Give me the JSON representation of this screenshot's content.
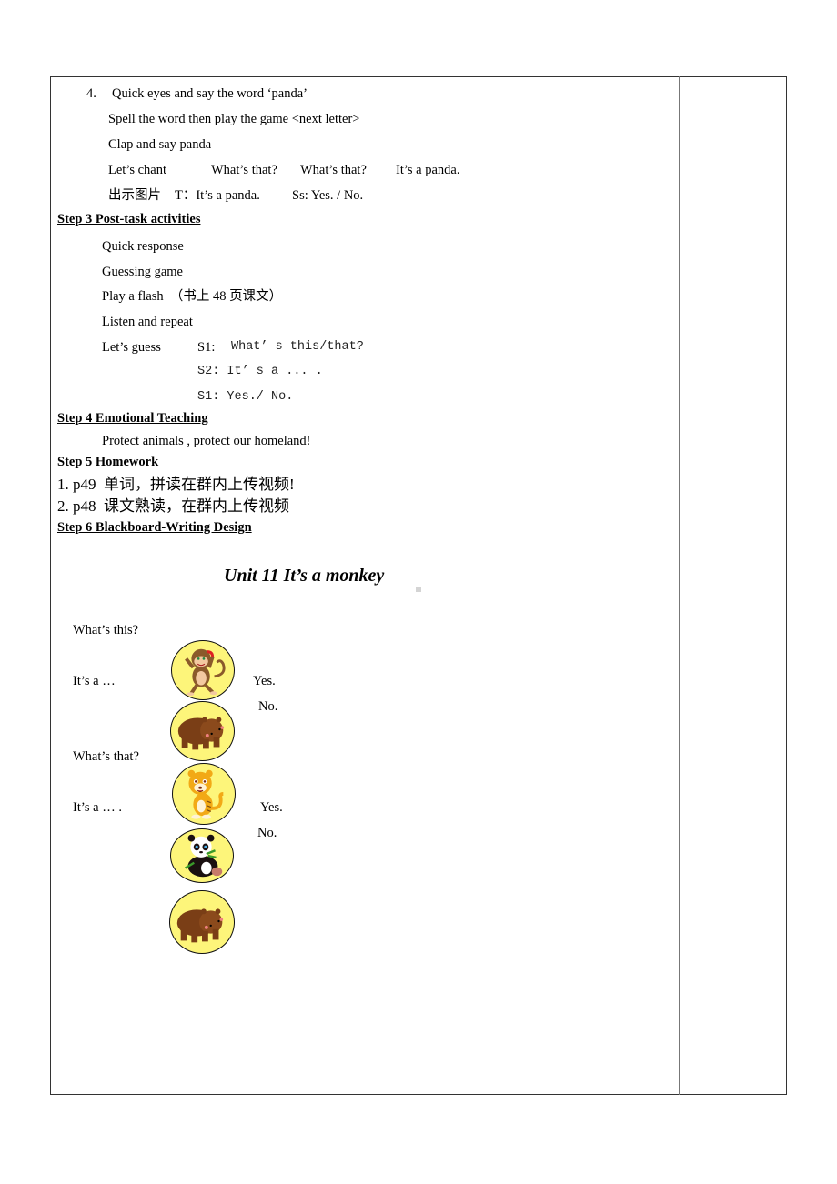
{
  "step2_tail": {
    "item4_number": "4.",
    "item4_text": "Quick eyes and say the word ‘panda’",
    "lines": [
      "Spell the word then play the game <next letter>",
      "Clap and say panda"
    ],
    "chant_label": "Let’s chant",
    "chant_parts": [
      "What’s that?",
      "What’s that?",
      "It’s a panda."
    ],
    "show_picture": "出示图片",
    "teacher_line": "T：It’s a panda.",
    "students_line": "Ss: Yes. / No."
  },
  "step3": {
    "heading": "Step 3 Post-task activities",
    "items": [
      "Quick response",
      "Guessing game",
      "Play a flash  （书上 48 页课文）",
      "Listen and repeat"
    ],
    "guess_label": "Let’s guess",
    "guess_s1_label": "S1:",
    "guess_lines": [
      "What’ s this/that?",
      "S2: It’ s a ... .",
      "S1: Yes./ No."
    ]
  },
  "step4": {
    "heading": "Step 4 Emotional Teaching",
    "text": "Protect animals , protect our homeland!"
  },
  "step5": {
    "heading": "Step 5 Homework",
    "items": [
      "1. p49  单词，拼读在群内上传视频!",
      "2. p48  课文熟读，在群内上传视频"
    ]
  },
  "step6": {
    "heading": "Step 6 Blackboard-Writing Design",
    "board_title": "Unit 11 It’s a monkey",
    "q1": "What’s this?",
    "a1": "It’s a …",
    "yes1": "Yes.",
    "no1": "No.",
    "q2": "What’s that?",
    "a2": "It’s a … .",
    "yes2": "Yes.",
    "no2": "No.",
    "pictures": [
      "monkey",
      "bear",
      "tiger",
      "panda",
      "bear"
    ],
    "circle_color": "#fdf57a"
  }
}
